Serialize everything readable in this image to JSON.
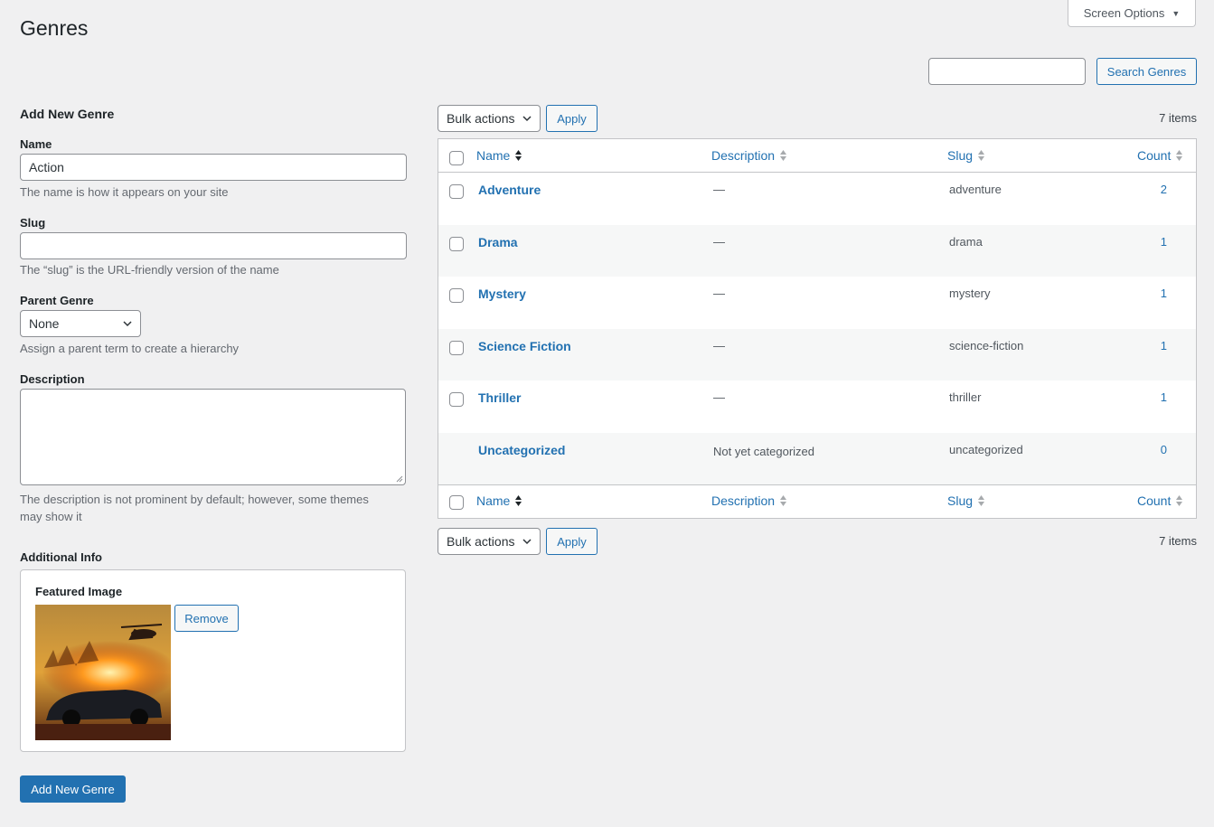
{
  "page": {
    "title": "Genres",
    "screen_options": "Screen Options"
  },
  "search": {
    "button": "Search Genres",
    "value": ""
  },
  "form": {
    "heading": "Add New Genre",
    "name": {
      "label": "Name",
      "value": "Action",
      "help": "The name is how it appears on your site"
    },
    "slug": {
      "label": "Slug",
      "value": "",
      "help": "The “slug” is the URL-friendly version of the name"
    },
    "parent": {
      "label": "Parent Genre",
      "selected": "None",
      "help": "Assign a parent term to create a hierarchy"
    },
    "description": {
      "label": "Description",
      "help_line1": "The description is not prominent by default; however, some themes",
      "help_line2": "may show it"
    },
    "additional_info": {
      "label": "Additional Info",
      "featured_image_label": "Featured Image",
      "remove_button": "Remove"
    },
    "submit": "Add New Genre"
  },
  "table": {
    "bulk_actions": "Bulk actions",
    "apply": "Apply",
    "items_count": "7 items",
    "columns": {
      "name": "Name",
      "description": "Description",
      "slug": "Slug",
      "count": "Count"
    },
    "rows": [
      {
        "name": "Adventure",
        "description": "—",
        "slug": "adventure",
        "count": "2",
        "has_checkbox": true
      },
      {
        "name": "Drama",
        "description": "—",
        "slug": "drama",
        "count": "1",
        "has_checkbox": true
      },
      {
        "name": "Mystery",
        "description": "—",
        "slug": "mystery",
        "count": "1",
        "has_checkbox": true
      },
      {
        "name": "Science Fiction",
        "description": "—",
        "slug": "science-fiction",
        "count": "1",
        "has_checkbox": true
      },
      {
        "name": "Thriller",
        "description": "—",
        "slug": "thriller",
        "count": "1",
        "has_checkbox": true
      },
      {
        "name": "Uncategorized",
        "description": "Not yet categorized",
        "slug": "uncategorized",
        "count": "0",
        "has_checkbox": false
      }
    ]
  },
  "icons": {
    "dropdown": "chevron-down-icon",
    "sort": "sort-arrows-icon",
    "sort_up": "sort-asc-icon",
    "screen_options_arrow": "caret-down-icon"
  },
  "colors": {
    "accent": "#2271b1",
    "background": "#f0f0f1",
    "text": "#1d2327",
    "muted": "#646970"
  }
}
